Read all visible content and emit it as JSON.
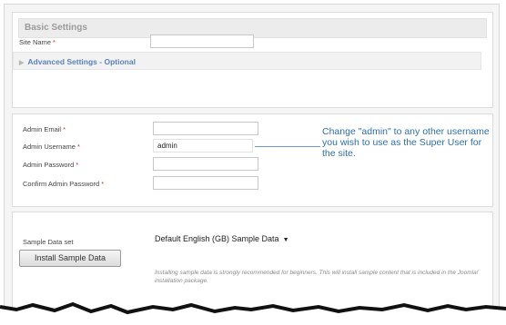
{
  "basic": {
    "heading": "Basic Settings",
    "site_name_label": "Site Name",
    "required_mark": "*",
    "site_name_value": "",
    "advanced_toggle": "Advanced Settings - Optional"
  },
  "admin": {
    "email_label": "Admin Email",
    "username_label": "Admin Username",
    "password_label": "Admin Password",
    "confirm_label": "Confirm Admin Password",
    "email_value": "",
    "username_value": "admin",
    "password_value": "",
    "confirm_value": "",
    "callout": "Change \"admin\" to any other username you wish to use as the Super User for the site."
  },
  "sample": {
    "label": "Sample Data set",
    "selected": "Default English (GB) Sample Data",
    "install_button": "Install Sample Data",
    "note": "Installing sample data is strongly recommended for beginners. This will install sample content that is included in the Joomla! installation package."
  },
  "colors": {
    "callout_text": "#2f6fa7",
    "link": "#5b82b8",
    "required": "#c0392b"
  }
}
